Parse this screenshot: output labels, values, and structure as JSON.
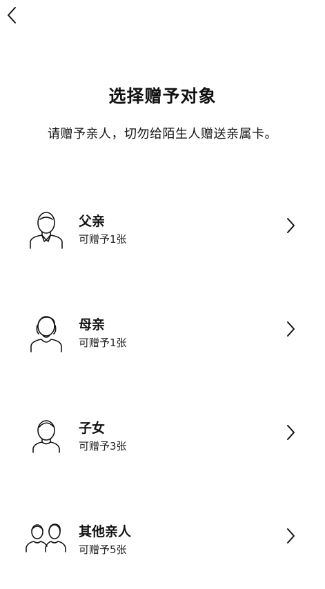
{
  "header": {
    "back_icon": "chevron-left-icon"
  },
  "page": {
    "title": "选择赠予对象",
    "subtitle": "请赠予亲人，切勿给陌生人赠送亲属卡。"
  },
  "recipients": [
    {
      "name": "父亲",
      "quota": "可赠予1张",
      "icon": "father-avatar-icon"
    },
    {
      "name": "母亲",
      "quota": "可赠予1张",
      "icon": "mother-avatar-icon"
    },
    {
      "name": "子女",
      "quota": "可赠予3张",
      "icon": "child-avatar-icon"
    },
    {
      "name": "其他亲人",
      "quota": "可赠予5张",
      "icon": "relatives-avatar-icon"
    }
  ],
  "theme": {
    "text_color": "#111111",
    "background": "#ffffff"
  }
}
